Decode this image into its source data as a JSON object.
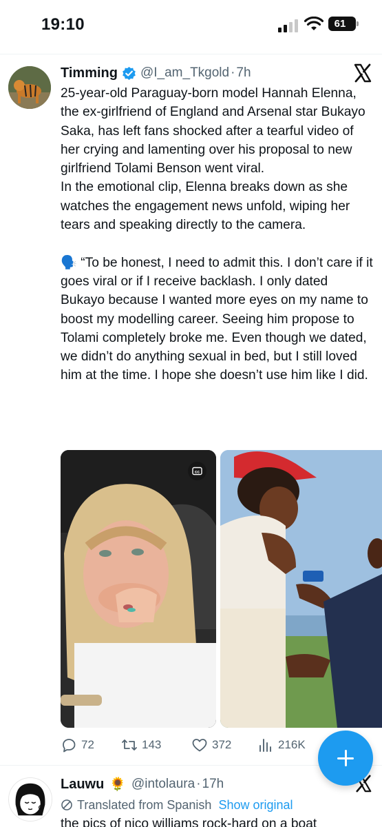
{
  "status_bar": {
    "time": "19:10",
    "battery_level": "61"
  },
  "tweet": {
    "author_name": "Timming",
    "handle": "@I_am_Tkgold",
    "separator": "·",
    "time_ago": "7h",
    "text_part1": "25-year-old Paraguay-born model Hannah Elenna, the ex-girlfriend of England and Arsenal star Bukayo Saka, has left fans shocked after a tearful video of her crying and lamenting over his proposal to new girlfriend Tolami Benson went viral.\nIn the emotional clip, Elenna breaks down as she watches the engagement news unfold, wiping her tears and speaking directly to the camera.\n\n",
    "speaking_emoji": "🗣️",
    "text_part2": " “To be honest, I need to admit this. I don’t care if it goes viral or if I receive backlash. I only dated Bukayo because I wanted more eyes on my name to boost my modelling career. Seeing him propose to Tolami completely broke me. Even though we dated, we didn’t do anything sexual in bed, but I still loved him at the time. I hope she doesn’t use him like I did.",
    "cc_label": "cc",
    "actions": {
      "replies": "72",
      "retweets": "143",
      "likes": "372",
      "views": "216K"
    }
  },
  "tweet2": {
    "author_name": "Lauwu",
    "emoji": "🌻",
    "handle": "@intolaura",
    "separator": "·",
    "time_ago": "17h",
    "translated_label": "Translated from Spanish",
    "show_original": "Show original",
    "text": "the pics of nico williams rock-hard on a boat"
  },
  "colors": {
    "accent": "#1d9bf0",
    "secondary_text": "#536471",
    "primary_text": "#0f1419"
  },
  "icons": [
    "signal-icon",
    "wifi-icon",
    "battery-icon",
    "verified-badge-icon",
    "x-logo-icon",
    "closed-captions-icon",
    "reply-icon",
    "retweet-icon",
    "like-icon",
    "views-icon",
    "compose-plus-icon",
    "translate-icon"
  ]
}
